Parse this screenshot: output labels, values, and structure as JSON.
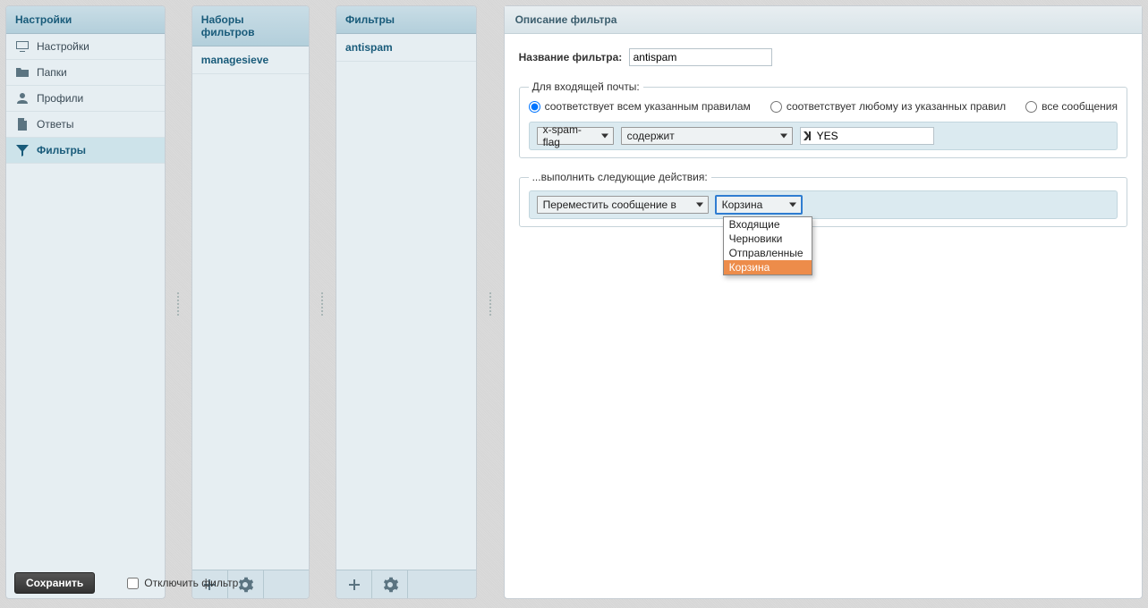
{
  "settings_panel": {
    "title": "Настройки",
    "items": [
      {
        "icon": "monitor",
        "label": "Настройки"
      },
      {
        "icon": "folder",
        "label": "Папки"
      },
      {
        "icon": "user",
        "label": "Профили"
      },
      {
        "icon": "file",
        "label": "Ответы"
      },
      {
        "icon": "filter",
        "label": "Фильтры"
      }
    ],
    "active_index": 4
  },
  "sets_panel": {
    "title": "Наборы фильтров",
    "items": [
      "managesieve"
    ]
  },
  "filters_panel": {
    "title": "Фильтры",
    "items": [
      "antispam"
    ]
  },
  "detail": {
    "title": "Описание фильтра",
    "name_label": "Название фильтра:",
    "name_value": "antispam",
    "incoming_legend": "Для входящей почты:",
    "radios": {
      "all": "соответствует всем указанным правилам",
      "any": "соответствует любому из указанных правил",
      "every": "все сообщения"
    },
    "rule": {
      "header": "x-spam-flag",
      "condition": "содержит",
      "value": "YES"
    },
    "actions_legend": "...выполнить следующие действия:",
    "action": {
      "type": "Переместить сообщение в",
      "folder": "Корзина"
    },
    "folder_options": [
      "Входящие",
      "Черновики",
      "Отправленные",
      "Корзина"
    ],
    "folder_hover_index": 3,
    "save_label": "Сохранить",
    "disable_label": "Отключить фильтр"
  }
}
